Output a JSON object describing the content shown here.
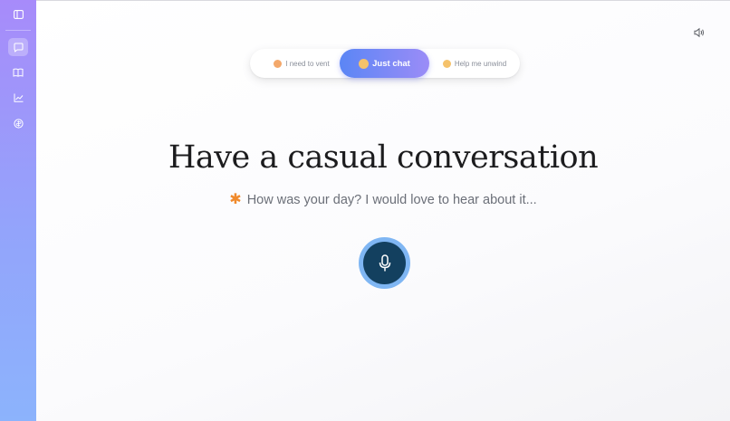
{
  "sidebar": {
    "items": [
      {
        "name": "toggle-sidebar",
        "icon": "panel-left-icon"
      },
      {
        "name": "chat",
        "icon": "chat-bubble-icon",
        "active": true
      },
      {
        "name": "journal",
        "icon": "book-icon"
      },
      {
        "name": "insights",
        "icon": "chart-icon"
      },
      {
        "name": "explore",
        "icon": "compass-icon"
      }
    ]
  },
  "header": {
    "sound_icon": "speaker-icon"
  },
  "moods": [
    {
      "label": "I need to vent",
      "active": false
    },
    {
      "label": "Just chat",
      "active": true
    },
    {
      "label": "Help me unwind",
      "active": false
    }
  ],
  "main": {
    "title": "Have a casual conversation",
    "prompt_marker": "✱",
    "prompt": "How was your day? I would love to hear about it..."
  },
  "mic": {
    "icon": "microphone-icon"
  },
  "colors": {
    "accent_start": "#5b86f5",
    "accent_end": "#9b8cf7",
    "mic_button": "#13405f",
    "mic_ring": "#7fb6f3",
    "asterisk": "#f08a2c"
  }
}
